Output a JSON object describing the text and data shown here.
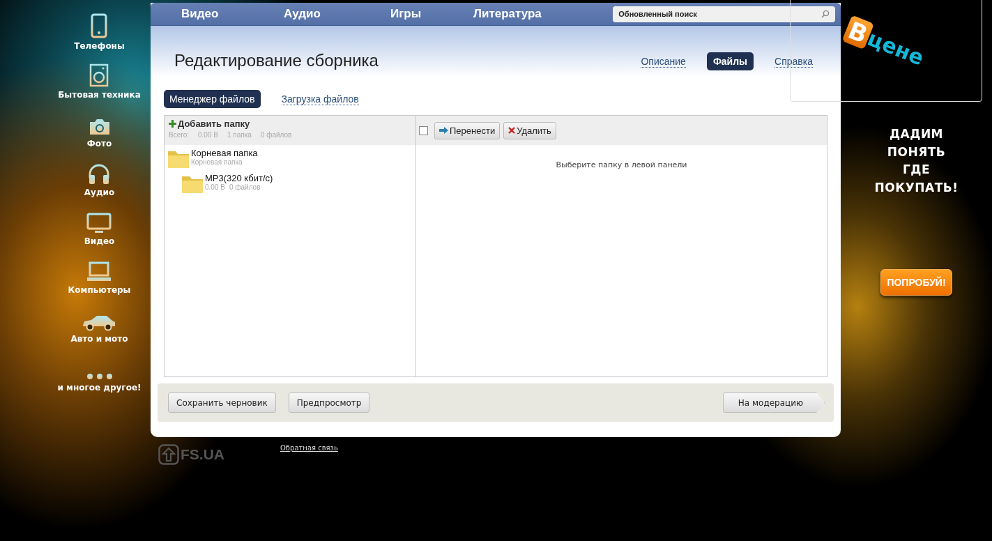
{
  "sidebar": {
    "items": [
      {
        "kind": "phone",
        "label": "Телефоны"
      },
      {
        "kind": "washer",
        "label": "Бытовая техника"
      },
      {
        "kind": "camera",
        "label": "Фото"
      },
      {
        "kind": "headphones",
        "label": "Аудио"
      },
      {
        "kind": "monitor",
        "label": "Видео"
      },
      {
        "kind": "laptop",
        "label": "Компьютеры"
      },
      {
        "kind": "car",
        "label": "Авто и мото"
      },
      {
        "kind": "dots",
        "label": "и многое другое!"
      }
    ]
  },
  "nav": {
    "items": [
      "Видео",
      "Аудио",
      "Игры",
      "Литература"
    ],
    "search": {
      "value": "Обновленный поиск"
    }
  },
  "page": {
    "title": "Редактирование сборника",
    "tabs": [
      {
        "label": "Описание",
        "selected": false
      },
      {
        "label": "Файлы",
        "selected": true
      },
      {
        "label": "Справка",
        "selected": false
      }
    ],
    "subtabs": [
      {
        "label": "Менеджер файлов",
        "selected": true
      },
      {
        "label": "Загрузка файлов",
        "selected": false
      }
    ]
  },
  "folders": {
    "add_label": "Добавить папку",
    "stats": [
      "Всего:",
      "0.00 B",
      "1 папка",
      "0 файлов"
    ],
    "tree": [
      {
        "name": "Корневая папка",
        "details": [
          "Корневая папка"
        ],
        "children": [
          {
            "name": "MP3(320 кбит/с)",
            "details": [
              "0.00 B",
              "0 файлов"
            ]
          }
        ]
      }
    ]
  },
  "files": {
    "select_all": {
      "checked": false
    },
    "actions": [
      {
        "kind": "move",
        "label": "Перенести"
      },
      {
        "kind": "delete",
        "label": "Удалить"
      }
    ],
    "message": "Выберите папку в левой панели"
  },
  "footer_buttons": [
    {
      "kind": "plain",
      "label": "Сохранить черновик"
    },
    {
      "kind": "plain",
      "label": "Предпросмотр"
    },
    {
      "kind": "arrow",
      "label": "На модерацию"
    }
  ],
  "footer": {
    "logo": "FS.UA",
    "link": "Обратная связь"
  },
  "ad": {
    "logo": [
      "В",
      "цене"
    ],
    "slogan": [
      "ДАДИМ",
      "ПОНЯТЬ",
      "ГДЕ",
      "ПОКУПАТЬ!"
    ],
    "button": "ПОПРОБУЙ!"
  }
}
